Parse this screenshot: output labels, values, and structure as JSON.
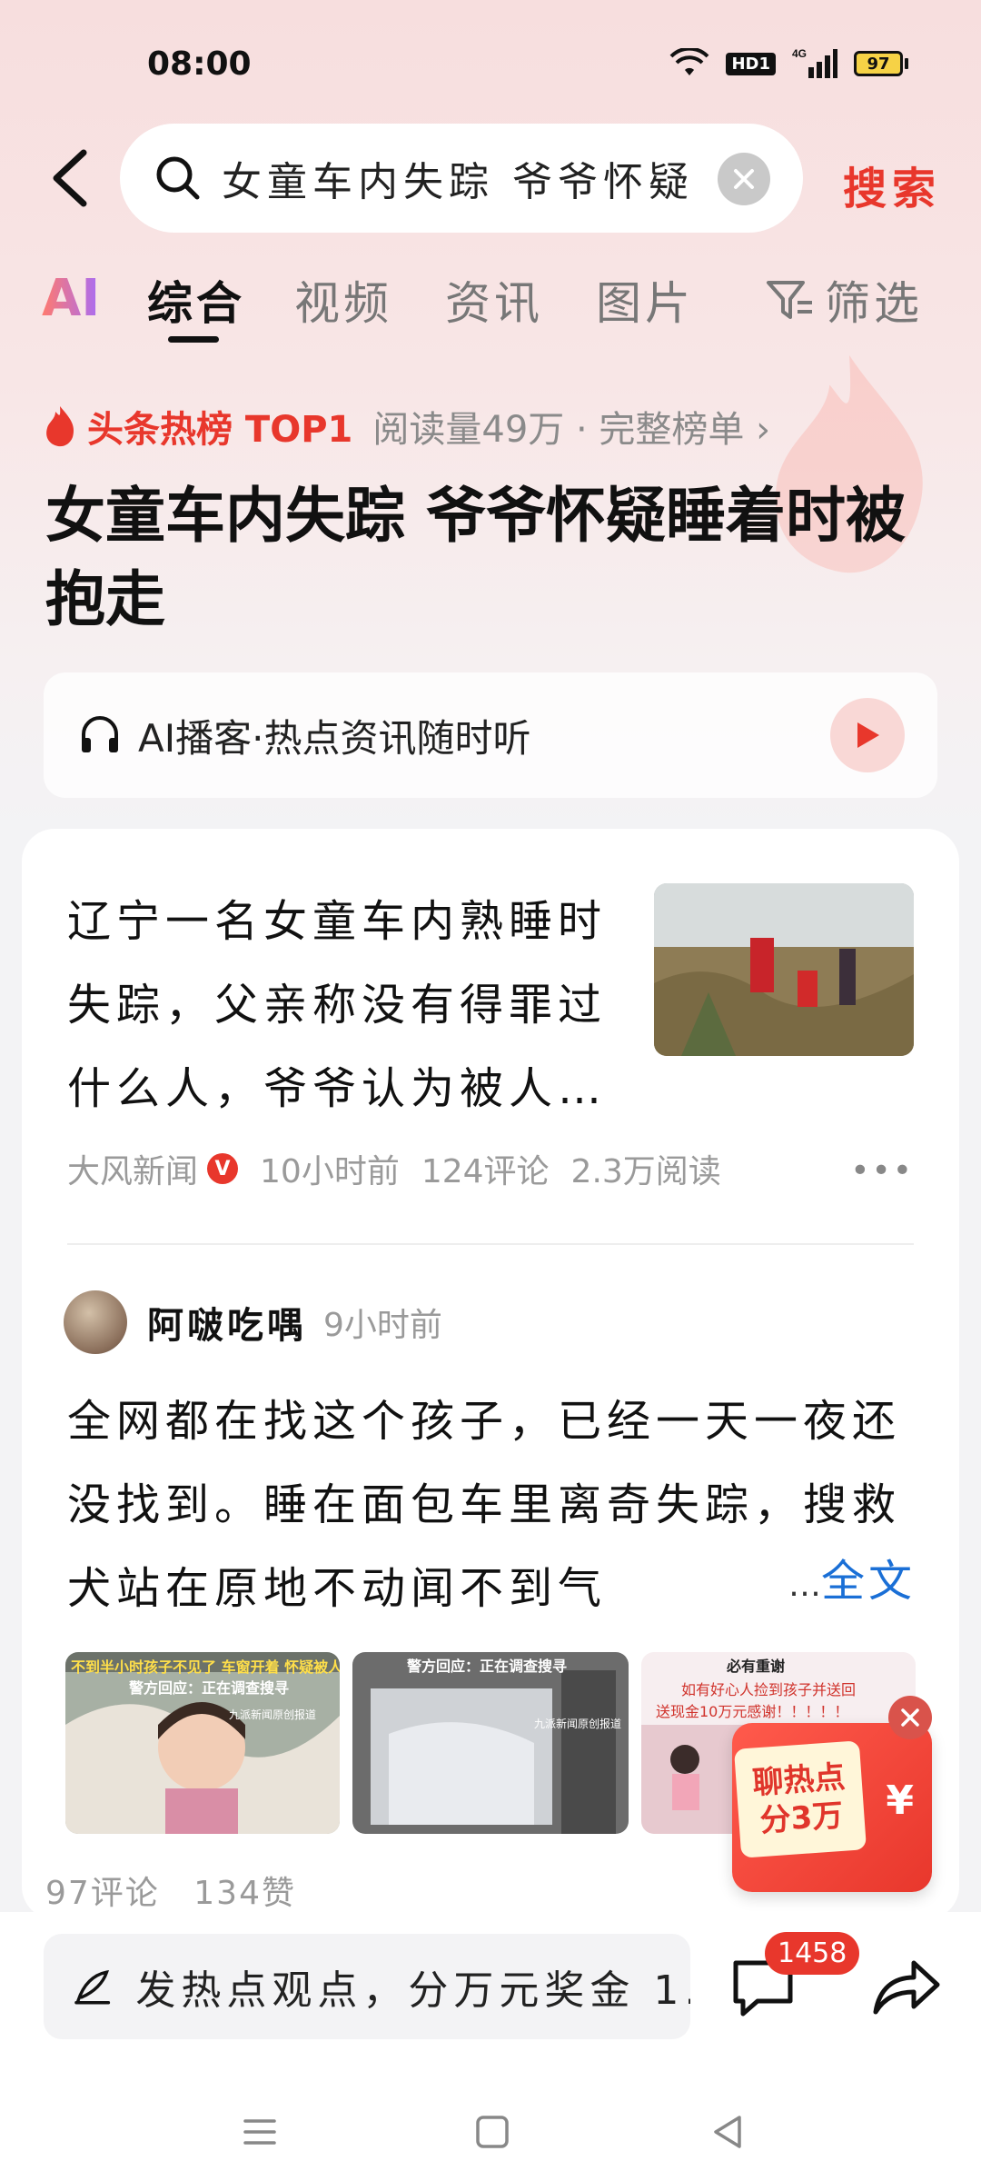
{
  "status_bar": {
    "time": "08:00",
    "network": "4G",
    "hd": "HD1",
    "battery": "97"
  },
  "search": {
    "query": "女童车内失踪 爷爷怀疑",
    "button": "搜索"
  },
  "tabs": [
    {
      "label": "AI"
    },
    {
      "label": "综合"
    },
    {
      "label": "视频"
    },
    {
      "label": "资讯"
    },
    {
      "label": "图片"
    },
    {
      "label": "筛选"
    }
  ],
  "hot": {
    "title": "头条热榜 TOP1",
    "meta": "阅读量49万 · 完整榜单 ›",
    "headline": "女童车内失踪 爷爷怀疑睡着时被抱走"
  },
  "podcast": {
    "label": "AI播客·热点资讯随时听"
  },
  "article": {
    "title": "辽宁一名女童车内熟睡时失踪，父亲称没有得罪过什么人，爷爷认为被人…",
    "source": "大风新闻",
    "time": "10小时前",
    "comments": "124评论",
    "reads": "2.3万阅读"
  },
  "post": {
    "author": "阿啵吃喁",
    "time": "9小时前",
    "text": "全网都在找这个孩子，已经一天一夜还没找到。睡在面包车里离奇失踪，搜救犬站在原地不动闻不到气",
    "more_dots": "…",
    "more_label": "全文",
    "images": [
      {
        "caption_1": "不到半小时孩子不见了 车窗开着 怀疑被人抱走",
        "caption_2": "警方回应：正在调查搜寻",
        "watermark": "九派新闻原创报道"
      },
      {
        "caption_1": "警方回应：正在调查搜寻",
        "watermark": "九派新闻原创报道"
      },
      {
        "caption_1": "必有重谢",
        "caption_2": "如有好心人捡到孩子并送回",
        "caption_3": "送现金10万元感谢！！！！！"
      }
    ],
    "comments": "97评论",
    "likes": "134赞"
  },
  "promo": {
    "line1": "聊热点",
    "line2": "分3万",
    "symbol": "¥"
  },
  "bottom": {
    "comment_placeholder": "发热点观点，分万元奖金 1.",
    "comment_count": "1458"
  }
}
